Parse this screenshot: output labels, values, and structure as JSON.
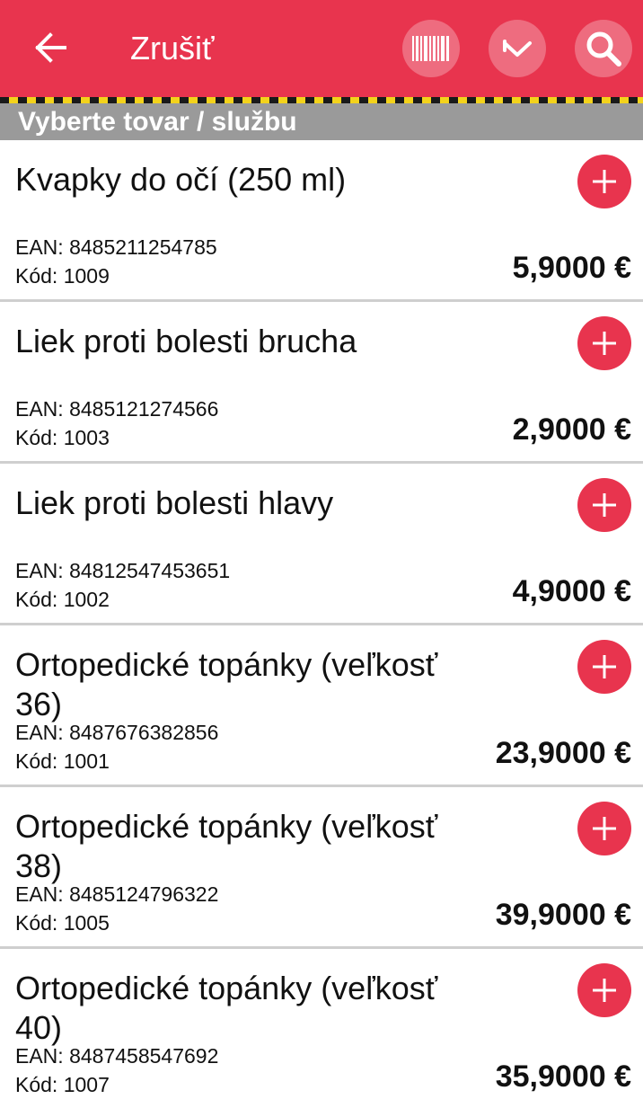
{
  "appbar": {
    "cancel_label": "Zrušiť"
  },
  "section": {
    "title": "Vyberte tovar / službu"
  },
  "icons": {
    "back": "arrow-left-icon",
    "barcode": "barcode-icon",
    "chevron": "chevron-down-icon",
    "search": "search-icon",
    "add": "plus-icon"
  },
  "colors": {
    "accent": "#e8344e",
    "section_bg": "#9a9a9a",
    "divider": "#cfcfcf"
  },
  "products": [
    {
      "name": "Kvapky do očí (250 ml)",
      "ean": "EAN: 8485211254785",
      "code": "Kód: 1009",
      "price": "5,9000 €"
    },
    {
      "name": "Liek proti bolesti brucha",
      "ean": "EAN: 8485121274566",
      "code": "Kód: 1003",
      "price": "2,9000 €"
    },
    {
      "name": "Liek proti bolesti hlavy",
      "ean": "EAN: 84812547453651",
      "code": "Kód: 1002",
      "price": "4,9000 €"
    },
    {
      "name": "Ortopedické topánky (veľkosť 36)",
      "ean": "EAN: 8487676382856",
      "code": "Kód: 1001",
      "price": "23,9000 €"
    },
    {
      "name": "Ortopedické topánky (veľkosť 38)",
      "ean": "EAN: 8485124796322",
      "code": "Kód: 1005",
      "price": "39,9000 €"
    },
    {
      "name": "Ortopedické topánky (veľkosť 40)",
      "ean": "EAN: 8487458547692",
      "code": "Kód: 1007",
      "price": "35,9000 €"
    }
  ]
}
